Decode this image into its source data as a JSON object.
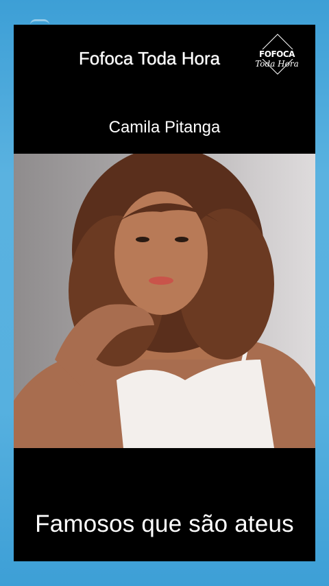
{
  "header": {
    "title": "Fofoca Toda Hora"
  },
  "logo": {
    "line1": "FOFOCA",
    "line2": "Toda Hora"
  },
  "subtitle": "Camila Pitanga",
  "photo": {
    "subject": "portrait-photo"
  },
  "footer": {
    "title": "Famosos que são ateus"
  },
  "colors": {
    "background": "#56b0df",
    "card": "#000000",
    "text": "#ffffff"
  }
}
